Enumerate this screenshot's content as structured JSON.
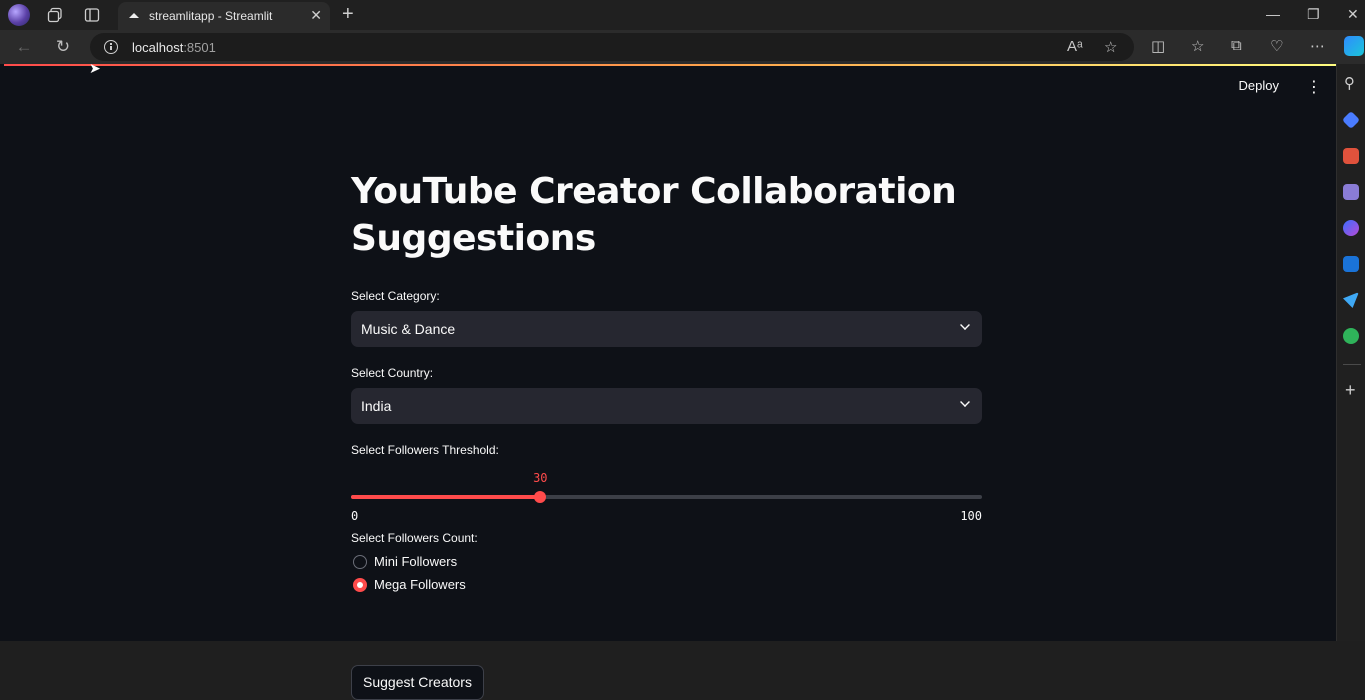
{
  "browser": {
    "tab_title": "streamlitapp - Streamlit",
    "url_host": "localhost",
    "url_port": ":8501"
  },
  "app": {
    "deploy_label": "Deploy",
    "title": "YouTube Creator Collaboration Suggestions",
    "category": {
      "label": "Select Category:",
      "value": "Music & Dance"
    },
    "country": {
      "label": "Select Country:",
      "value": "India"
    },
    "threshold": {
      "label": "Select Followers Threshold:",
      "value": 30,
      "min": 0,
      "max": 100
    },
    "followers_count": {
      "label": "Select Followers Count:",
      "options": [
        {
          "label": "Mini Followers",
          "selected": false
        },
        {
          "label": "Mega Followers",
          "selected": true
        }
      ]
    },
    "suggest_button": "Suggest Creators"
  },
  "colors": {
    "accent": "#ff4b4b",
    "app_bg": "#0e1117",
    "input_bg": "#262730"
  }
}
